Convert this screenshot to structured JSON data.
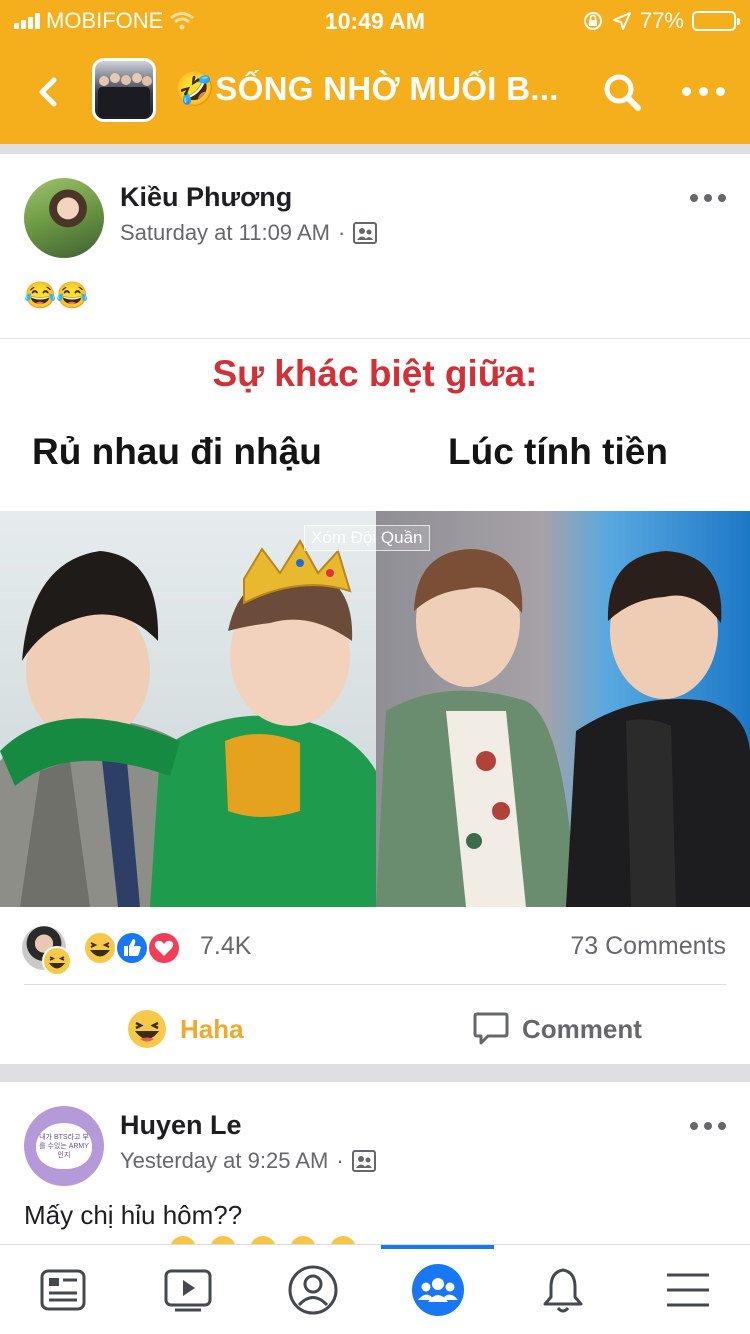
{
  "status_bar": {
    "carrier": "MOBIFONE",
    "time": "10:49 AM",
    "battery": "77%",
    "battery_level": 0.77
  },
  "header": {
    "group_name": "🤣SỐNG NHỜ MUỐI B...",
    "background_color": "#f5ae1c"
  },
  "posts": [
    {
      "author": "Kiều Phương",
      "timestamp": "Saturday at 11:09 AM",
      "separator": "·",
      "text": "😂😂",
      "image": {
        "title": "Sự khác biệt giữa:",
        "left_caption": "Rủ nhau đi nhậu",
        "right_caption": "Lúc tính tiền",
        "watermark": "Xóm Đội Quần"
      },
      "reaction_count": "7.4K",
      "comment_count": "73 Comments",
      "actions": {
        "haha_label": "Haha",
        "comment_label": "Comment"
      }
    },
    {
      "author": "Huyen Le",
      "timestamp": "Yesterday at 9:25 AM",
      "separator": "·",
      "avatar_text": "내가 BTS라고 부를 수있는 ARMY인지",
      "text": "Mấy chị hỉu hôm??"
    }
  ],
  "tabbar": {
    "tabs": [
      "news-feed-icon",
      "watch-icon",
      "profile-icon",
      "groups-icon",
      "notifications-icon",
      "menu-icon"
    ],
    "active_tab": "groups-icon",
    "active_color": "#1877f2"
  }
}
